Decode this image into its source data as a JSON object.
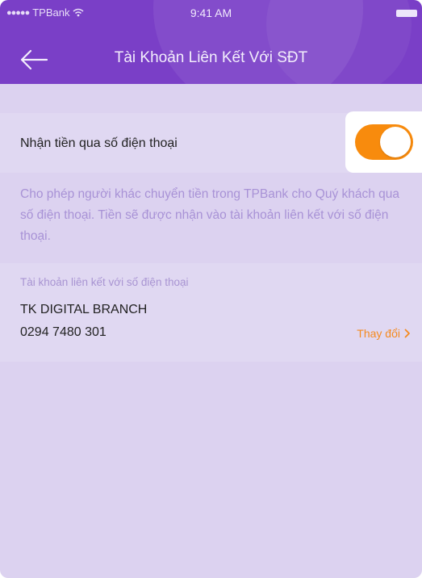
{
  "status_bar": {
    "signal_dots": "●●●●●",
    "carrier": "TPBank",
    "time": "9:41 AM"
  },
  "header": {
    "title": "Tài Khoản Liên Kết Với SĐT"
  },
  "receive_setting": {
    "label": "Nhận tiền qua số điện thoại",
    "enabled": true,
    "description": "Cho phép người khác chuyển tiền trong TPBank cho Quý khách qua số điện thoại. Tiền sẽ được nhận vào tài khoản liên kết với số điện thoại."
  },
  "linked_account": {
    "caption": "Tài khoản liên kết với số điện thoại",
    "name": "TK DIGITAL BRANCH",
    "number": "0294 7480 301",
    "change_label": "Thay đổi"
  },
  "colors": {
    "header": "#7a3fc7",
    "background": "#dcd2f0",
    "toggle_on": "#f88b0d",
    "link": "#f58a1f"
  }
}
